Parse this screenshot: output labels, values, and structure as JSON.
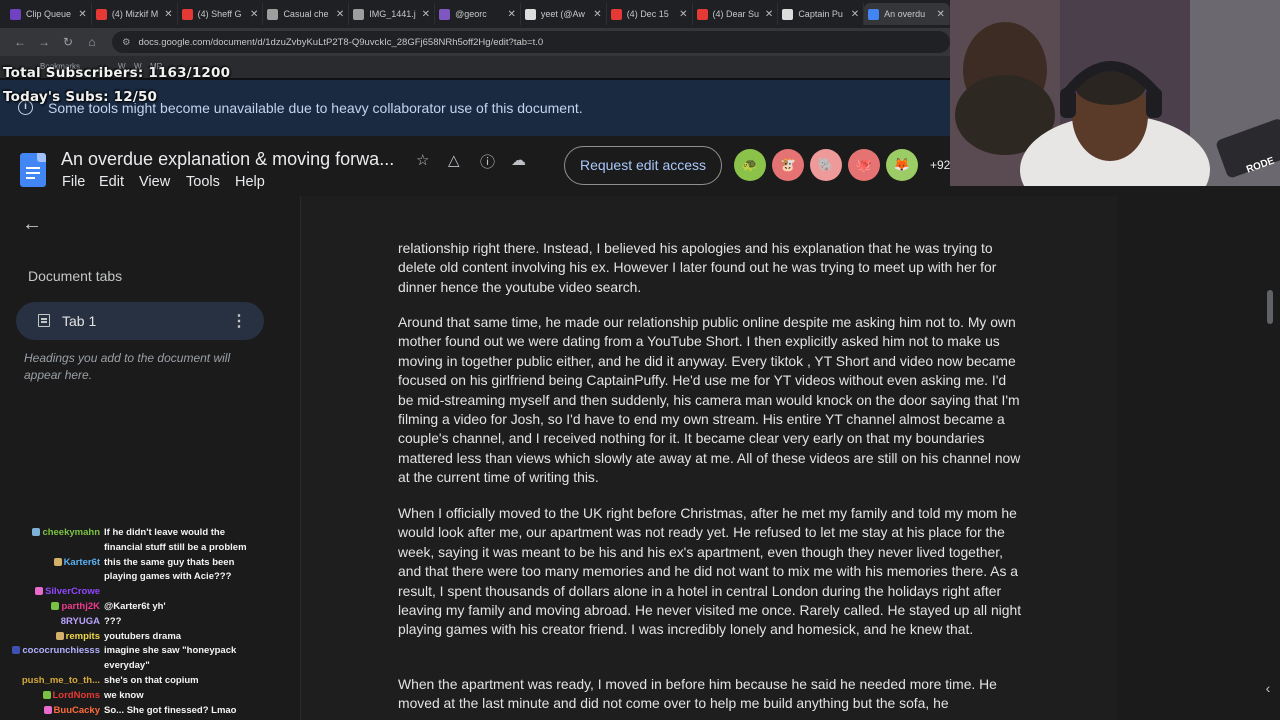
{
  "browser": {
    "tabs": [
      {
        "label": "Clip Queue",
        "color": "#6f42c1"
      },
      {
        "label": "(4) Mizkif M",
        "color": "#e53935"
      },
      {
        "label": "(4) Sheff G",
        "color": "#e53935"
      },
      {
        "label": "Casual che",
        "color": "#9e9e9e"
      },
      {
        "label": "IMG_1441.j",
        "color": "#9e9e9e"
      },
      {
        "label": "@georc",
        "color": "#7e57c2"
      },
      {
        "label": "yeet (@Aw",
        "color": "#dddddd"
      },
      {
        "label": "(4) Dec 15",
        "color": "#e53935"
      },
      {
        "label": "(4) Dear Su",
        "color": "#e53935"
      },
      {
        "label": "Captain Pu",
        "color": "#dddddd"
      },
      {
        "label": "An overdu",
        "color": "#4285f4"
      }
    ],
    "url": "docs.google.com/document/d/1dzuZvbyKuLtP2T8-Q9uvckIc_28GFj658NRh5off2Hg/edit?tab=t.0",
    "bookmarks": [
      "Bookmarks",
      "W",
      "W",
      "MR"
    ]
  },
  "overlay": {
    "total_subs": "Total Subscribers: 1163/1200",
    "todays_subs": "Today's Subs: 12/50"
  },
  "banner": {
    "text": "Some tools might become unavailable due to heavy collaborator use of this document."
  },
  "header": {
    "title": "An overdue explanation & moving forwa...",
    "menu": [
      "File",
      "Edit",
      "View",
      "Tools",
      "Help"
    ],
    "request_button": "Request edit access",
    "more_count": "+92",
    "avatars": [
      {
        "color": "#8bc34a",
        "glyph": "🐢"
      },
      {
        "color": "#e57373",
        "glyph": "🐮"
      },
      {
        "color": "#ef9a9a",
        "glyph": "🐘"
      },
      {
        "color": "#e57373",
        "glyph": "🐙"
      },
      {
        "color": "#9ccc65",
        "glyph": "🦊"
      }
    ]
  },
  "sidebar": {
    "section_title": "Document tabs",
    "tab_label": "Tab 1",
    "hint": "Headings you add to the document will appear here."
  },
  "chat": [
    {
      "name": "cheekymahn",
      "color": "#7cc242",
      "msg": "If he didn't leave would the",
      "badge": "#7fb1d8"
    },
    {
      "name": "",
      "color": "#ffffff",
      "msg": "financial stuff still be a problem",
      "badge": ""
    },
    {
      "name": "Karter6t",
      "color": "#5bb0f0",
      "msg": "this the same guy thats been",
      "badge": "#d4b16a"
    },
    {
      "name": "",
      "color": "#ffffff",
      "msg": "playing games with Acie???",
      "badge": ""
    },
    {
      "name": "SilverCrowe",
      "color": "#9146ff",
      "msg": "",
      "badge": "#e86bd0"
    },
    {
      "name": "parthj2K",
      "color": "#ee3a8c",
      "msg": "@Karter6t yh'",
      "badge": "#7cc242"
    },
    {
      "name": "8RYUGA",
      "color": "#b9a3ff",
      "msg": "???",
      "badge": ""
    },
    {
      "name": "rempits",
      "color": "#f0d84a",
      "msg": "youtubers drama",
      "badge": "#d4b16a"
    },
    {
      "name": "cococrunchiesss",
      "color": "#b0b0ff",
      "msg": "imagine she saw \"honeypack",
      "badge": "#3f51b5"
    },
    {
      "name": "",
      "color": "#ffffff",
      "msg": "everyday\"",
      "badge": ""
    },
    {
      "name": "push_me_to_th...",
      "color": "#d6a93a",
      "msg": "she's on that copium",
      "badge": ""
    },
    {
      "name": "LordNoms",
      "color": "#e53935",
      "msg": "we know",
      "badge": "#7cc242"
    },
    {
      "name": "BuuCacky",
      "color": "#ff6b3d",
      "msg": "So... She got finessed? Lmao",
      "badge": "#e86bd0"
    }
  ],
  "document": {
    "paragraphs": [
      "relationship right there. Instead, I believed his apologies and his explanation that he was trying to delete old content involving his ex. However I later found out he was trying to meet up with her for dinner hence the youtube video search.",
      "Around that same time, he made our relationship public online despite me asking him not to. My own mother found out we were dating from a YouTube Short. I then explicitly asked him not to make us moving in together public either, and he did it anyway. Every tiktok , YT Short and video now became focused on his girlfriend being CaptainPuffy. He'd use me for YT videos without even asking me. I'd be mid-streaming myself and then suddenly, his camera man would knock on the door saying that I'm filming a video for Josh, so I'd have to end my own stream. His entire YT channel almost became a couple's channel, and I received nothing for it. It became clear very early on that my boundaries mattered less than views which slowly ate away at me. All of these videos are still on his channel now at the current time of writing this.",
      "When I officially moved to the UK right before Christmas, after he met my family and told my mom he would look after me, our apartment was not ready yet. He refused to let me stay at his place for the week, saying it was meant to be his and his ex's apartment, even though they never lived together, and that there were too many memories and he did not want to mix me with his memories there. As a result, I spent thousands of dollars alone in a hotel in central London during the holidays right after leaving my family and moving abroad. He never visited me once. Rarely called. He stayed up all night playing games with his creator friend. I was incredibly lonely and homesick, and he knew that.",
      "When the apartment was ready, I moved in before him because he said he needed more time. He moved at the last minute and did not come over to help me build anything but the sofa, he"
    ]
  },
  "webcam": {
    "mic_label": "RODE"
  }
}
